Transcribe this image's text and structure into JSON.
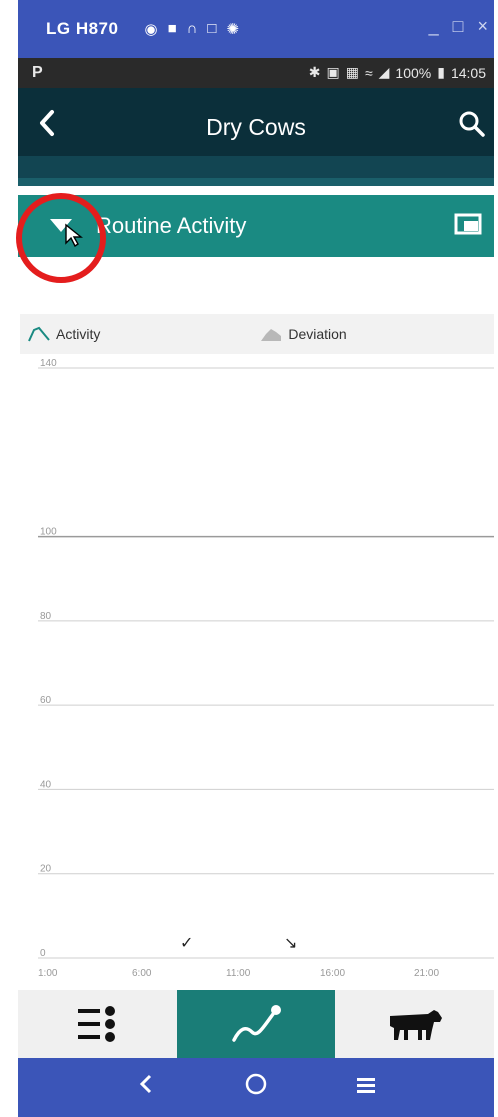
{
  "emulator": {
    "title": "LG H870",
    "controls": [
      "_",
      "□",
      "×"
    ]
  },
  "status_bar": {
    "carrier_icon": "P",
    "battery": "100%",
    "time": "14:05"
  },
  "app_header": {
    "title": "Dry Cows"
  },
  "section": {
    "title": "Routine Activity"
  },
  "legend": {
    "activity": "Activity",
    "deviation": "Deviation"
  },
  "chart_data": {
    "type": "line",
    "xlabel": "",
    "ylabel": "",
    "ylim": [
      0,
      140
    ],
    "yticks": [
      0,
      20,
      40,
      60,
      80,
      100,
      140
    ],
    "xticks": [
      "1:00",
      "6:00",
      "11:00",
      "16:00",
      "21:00"
    ],
    "series": [],
    "grid": true
  },
  "colors": {
    "emulator_bar": "#3b55b8",
    "app_header": "#0b2f3a",
    "section_header": "#1a8a82",
    "highlight": "#e41d1d",
    "active_nav": "#1a7d77"
  }
}
